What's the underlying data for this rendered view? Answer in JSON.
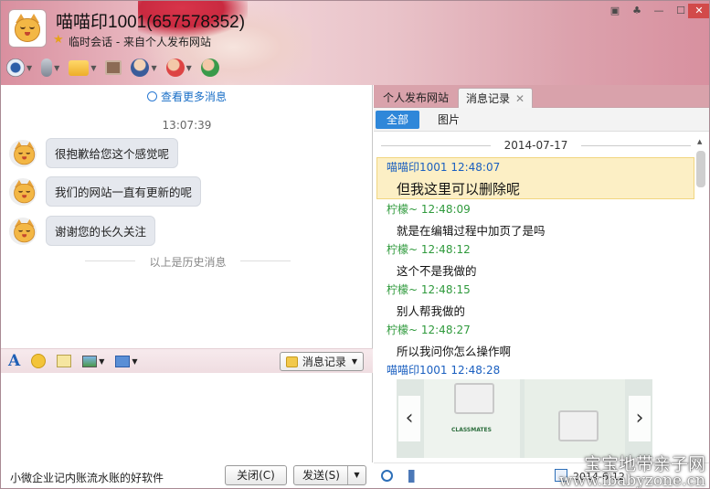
{
  "window": {
    "title": "喵喵印1001(657578352)",
    "subtitle": "临时会话 - 来自个人发布网站",
    "controls": [
      "restore",
      "skin",
      "minimize",
      "maximize",
      "close"
    ]
  },
  "toolbar": {
    "items": [
      "video-call-icon",
      "voice-call-icon",
      "file-transfer-icon",
      "remote-desktop-icon",
      "app-icon",
      "block-icon",
      "add-friend-icon"
    ]
  },
  "left": {
    "more_messages": "查看更多消息",
    "timestamp": "13:07:39",
    "messages": [
      "很抱歉给您这个感觉呢",
      "我们的网站一直有更新的呢",
      "谢谢您的长久关注"
    ],
    "history_divider": "以上是历史消息",
    "input_toolbar": {
      "history_button": "消息记录"
    },
    "ad_text": "小微企业记内账流水账的好软件",
    "close_button": "关闭(C)",
    "send_button": "发送(S)"
  },
  "right": {
    "tabs": [
      "个人发布网站",
      "消息记录"
    ],
    "filters": [
      "全部",
      "图片"
    ],
    "date": "2014-07-17",
    "records": [
      {
        "who": "喵喵印1001 12:48:07",
        "text": "但我这里可以删除呢",
        "color": "#1a5fc0"
      },
      {
        "who": "柠檬~ 12:48:09",
        "text": "就是在编辑过程中加页了是吗",
        "color": "#2f9a3c"
      },
      {
        "who": "柠檬~ 12:48:12",
        "text": "这个不是我做的",
        "color": "#2f9a3c"
      },
      {
        "who": "柠檬~ 12:48:15",
        "text": "别人帮我做的",
        "color": "#2f9a3c"
      },
      {
        "who": "柠檬~ 12:48:27",
        "text": "所以我问你怎么操作啊",
        "color": "#2f9a3c"
      },
      {
        "who": "喵喵印1001 12:48:28",
        "text": "",
        "color": "#1a5fc0"
      }
    ],
    "image_caption": "CLASSMATES",
    "date_footer": "2014-6-12"
  },
  "watermark": {
    "line1": "宝宝地带亲子网",
    "line2": "www.ibabyzone.cn"
  }
}
